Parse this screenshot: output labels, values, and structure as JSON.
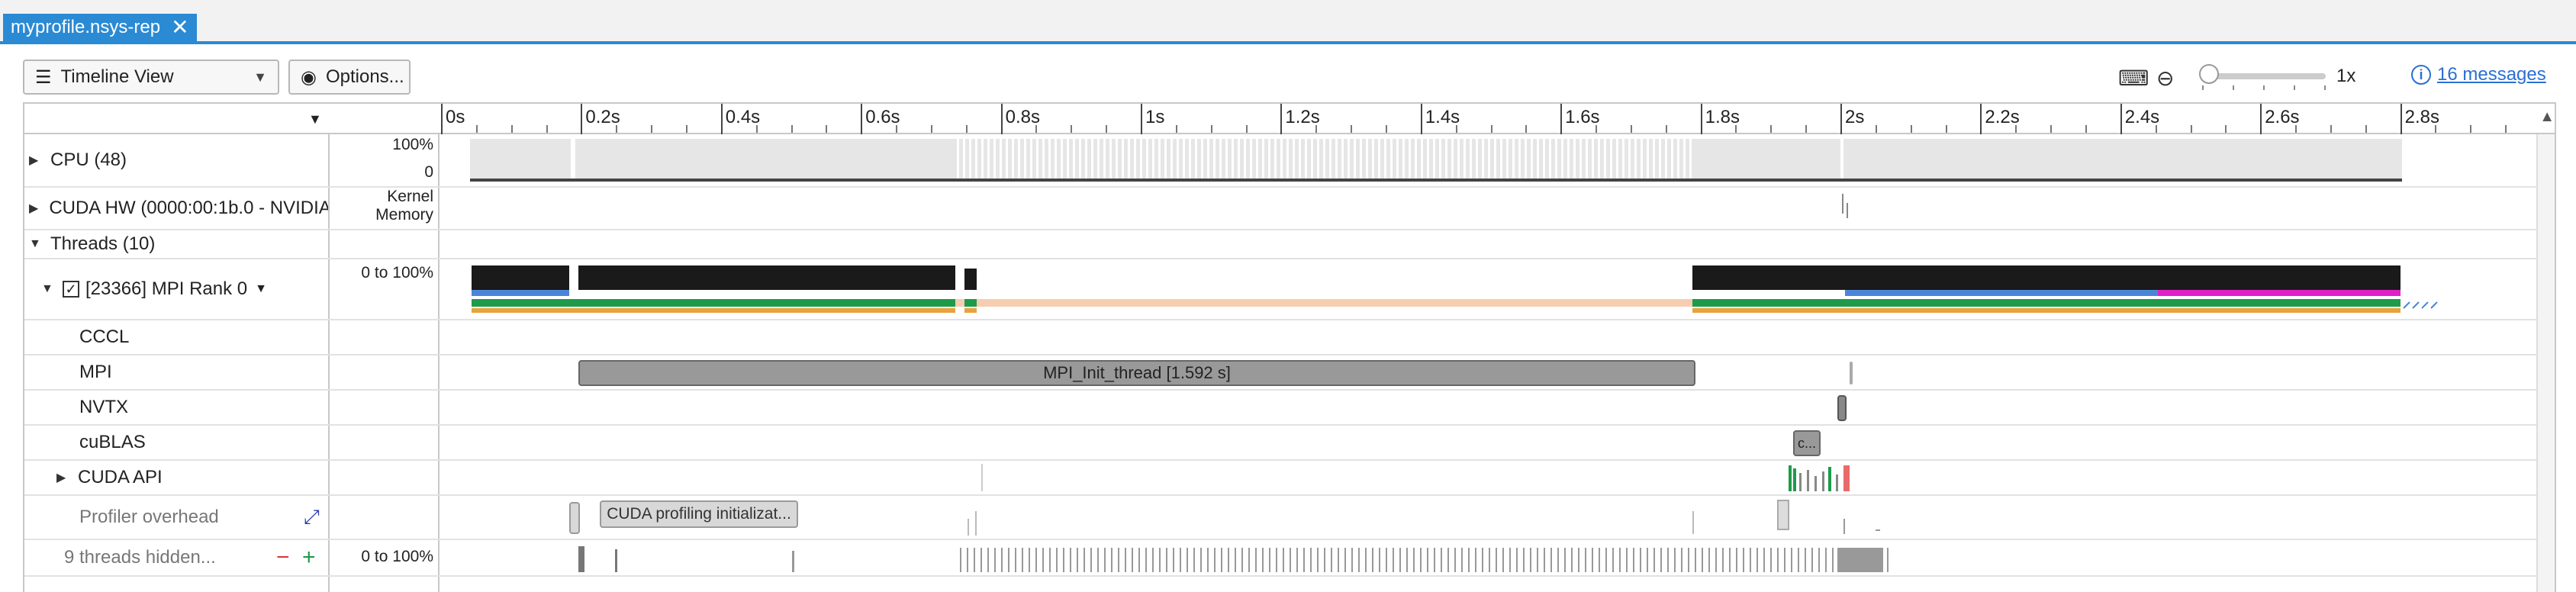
{
  "tab": {
    "title": "myprofile.nsys-rep"
  },
  "toolbar": {
    "view_label": "Timeline View",
    "options_label": "Options...",
    "zoom_level": "1x",
    "messages_label": "16 messages"
  },
  "ruler": {
    "ticks": [
      "0s",
      "0.2s",
      "0.4s",
      "0.6s",
      "0.8s",
      "1s",
      "1.2s",
      "1.4s",
      "1.6s",
      "1.8s",
      "2s",
      "2.2s",
      "2.4s",
      "2.6s",
      "2.8s"
    ]
  },
  "rows": {
    "cpu": {
      "label": "CPU (48)",
      "scale_top": "100%",
      "scale_bottom": "0"
    },
    "cuda_hw": {
      "label": "CUDA HW (0000:00:1b.0 - NVIDIA ...",
      "scale_line1": "Kernel",
      "scale_line2": "Memory"
    },
    "threads": {
      "label": "Threads (10)"
    },
    "rank0": {
      "label": "[23366] MPI Rank 0",
      "scale": "0 to 100%"
    },
    "cccl": {
      "label": "CCCL"
    },
    "mpi": {
      "label": "MPI",
      "bar_label": "MPI_Init_thread [1.592 s]"
    },
    "nvtx": {
      "label": "NVTX"
    },
    "cublas": {
      "label": "cuBLAS",
      "bar_label": "c..."
    },
    "cuda_api": {
      "label": "CUDA API"
    },
    "profiler": {
      "label": "Profiler overhead",
      "bar_label": "CUDA profiling initializat..."
    },
    "hidden": {
      "label": "9 threads hidden...",
      "scale": "0 to 100%"
    }
  },
  "colors": {
    "accent": "#2a8ad4",
    "thread_activity": "#1a1a1a",
    "blue": "#4a86d8",
    "green": "#1e9b4a",
    "orange": "#e8a33c",
    "peach": "#f7cdb0",
    "magenta": "#e020c8"
  }
}
